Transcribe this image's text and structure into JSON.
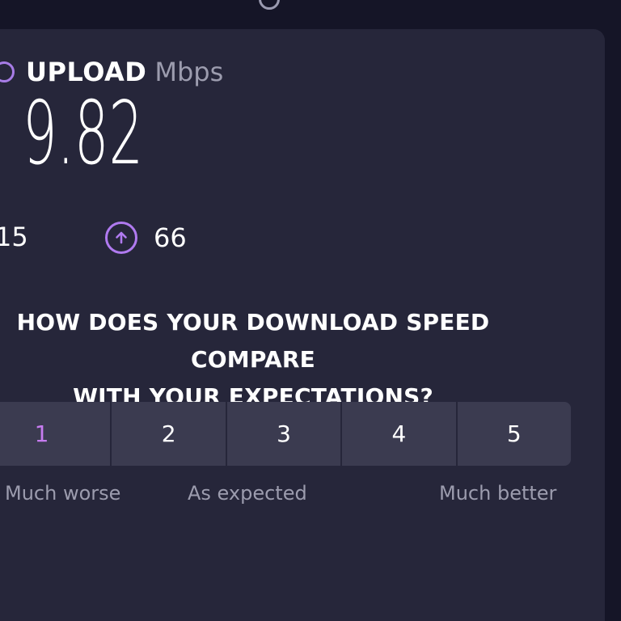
{
  "upload": {
    "label": "UPLOAD",
    "unit": "Mbps",
    "value": "9.82"
  },
  "ping": {
    "left_value": "15",
    "right_value": "66"
  },
  "question": {
    "line1": "HOW DOES YOUR DOWNLOAD SPEED COMPARE",
    "line2": "WITH YOUR EXPECTATIONS?"
  },
  "rating": {
    "options": [
      "1",
      "2",
      "3",
      "4",
      "5"
    ]
  },
  "scale": {
    "low": "Much worse",
    "mid": "As expected",
    "high": "Much better"
  },
  "colors": {
    "background": "#151527",
    "panel": "#26263a",
    "accent": "#b07af0",
    "button": "#3b3b50",
    "muted_text": "#9c9cae"
  },
  "icons": {
    "upload": "upload-icon",
    "ping": "arrow-up-circle-icon"
  }
}
